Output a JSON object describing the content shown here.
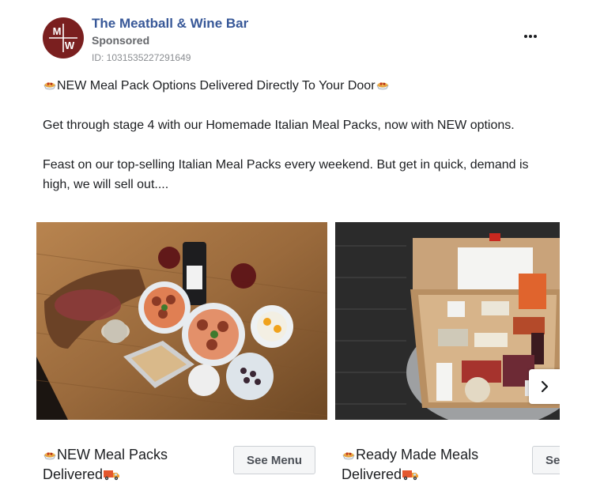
{
  "post": {
    "page_name": "The Meatball & Wine Bar",
    "sponsored": "Sponsored",
    "ad_id": "ID: 1031535227291649",
    "avatar_text": "MW",
    "headline": "NEW Meal Pack Options Delivered Directly To Your Door",
    "paragraph_1": "Get through stage 4 with our Homemade Italian Meal Packs, now with NEW options.",
    "paragraph_2": "Feast on our top-selling Italian Meal Packs every weekend. But get in quick, demand is high, we will sell out...."
  },
  "carousel": {
    "cards": [
      {
        "title_line1": "NEW Meal Packs",
        "title_line2": "Delivered",
        "cta": "See Menu"
      },
      {
        "title_line1": "Ready Made Meals",
        "title_line2": "Delivered",
        "cta": "See Menu"
      }
    ]
  },
  "icons": {
    "headline_emoji": "spaghetti-icon",
    "title_emoji": "spaghetti-icon",
    "truck_emoji": "delivery-truck-icon",
    "more": "more-options-icon",
    "next": "chevron-right-icon"
  },
  "colors": {
    "page_name": "#385898",
    "secondary_text": "#65676b",
    "avatar_bg": "#7a1f1f"
  }
}
